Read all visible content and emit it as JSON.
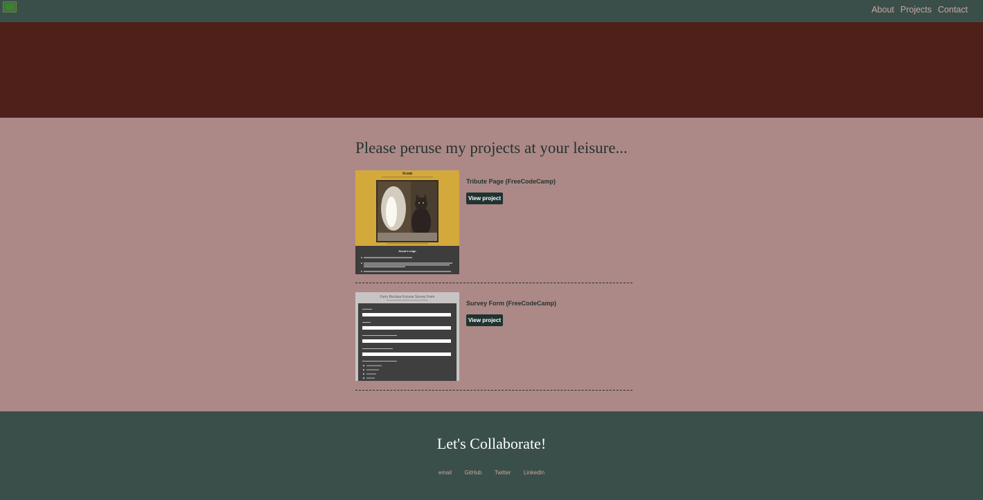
{
  "nav": {
    "menu_icon": "hamburger-icon",
    "links": [
      {
        "label": "About"
      },
      {
        "label": "Projects"
      },
      {
        "label": "Contact"
      }
    ]
  },
  "colors": {
    "navbar": "#3a4f49",
    "hero": "#4e2019",
    "projects_bg": "#ac8987",
    "button": "#1f3330",
    "nav_link": "#c9a7a7"
  },
  "projects": {
    "heading": "Please peruse my projects at your leisure...",
    "items": [
      {
        "title": "Tribute Page (FreeCodeCamp)",
        "button_label": "View project",
        "thumbnail": {
          "title": "Scout",
          "section_title": "Scout's reign"
        }
      },
      {
        "title": "Survey Form (FreeCodeCamp)",
        "button_label": "View project",
        "thumbnail": {
          "title": "Furry Recluse Excuse Survey Form"
        }
      }
    ]
  },
  "footer": {
    "title": "Let's Collaborate!",
    "links": [
      {
        "label": "email"
      },
      {
        "label": "GitHub"
      },
      {
        "label": "Twitter"
      },
      {
        "label": "LinkedIn"
      }
    ]
  }
}
